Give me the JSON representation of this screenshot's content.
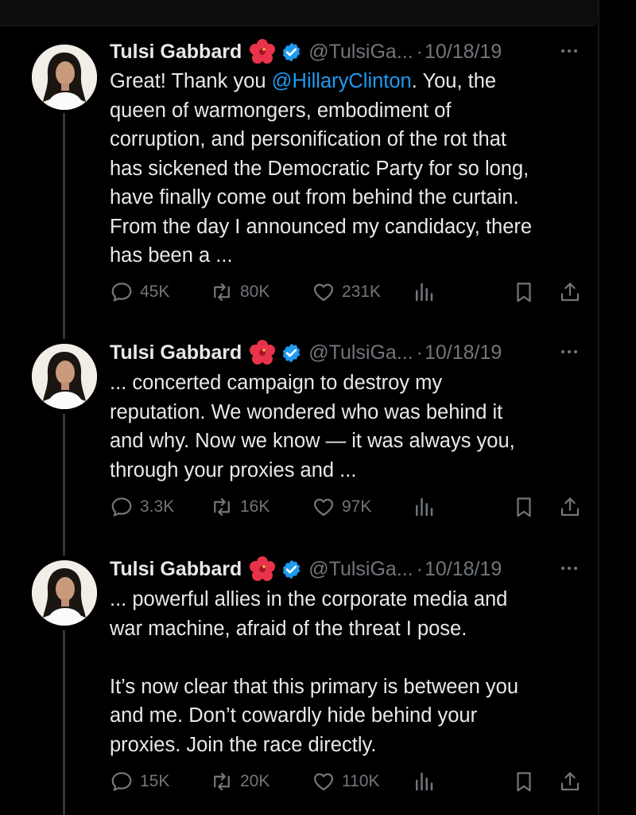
{
  "author": {
    "name": "Tulsi Gabbard",
    "handle": "@TulsiGa...",
    "emoji": "hibiscus-emoji",
    "verified_color": "#1d9bf0"
  },
  "tweets": [
    {
      "date": "10/18/19",
      "text_before": "Great! Thank you ",
      "mention": "@HillaryClinton",
      "text_after": ". You, the\nqueen of warmongers, embodiment of\ncorruption, and personification of the rot that\nhas sickened the Democratic Party for so long,\nhave finally come out from behind the curtain.\nFrom the day I announced my candidacy, there\nhas been a ...",
      "replies": "45K",
      "retweets": "80K",
      "likes": "231K"
    },
    {
      "date": "10/18/19",
      "text": "... concerted campaign to destroy my\nreputation. We wondered who was behind it\nand why. Now we know — it was always you,\nthrough your proxies and ...",
      "replies": "3.3K",
      "retweets": "16K",
      "likes": "97K"
    },
    {
      "date": "10/18/19",
      "text": "... powerful allies in the corporate media and\nwar machine, afraid of the threat I pose.\n\nIt’s now clear that this primary is between you\nand me. Don’t cowardly hide behind your\nproxies. Join the race directly.",
      "replies": "15K",
      "retweets": "20K",
      "likes": "110K"
    }
  ],
  "separator": "·",
  "colors": {
    "background": "#000000",
    "text": "#e7e9ea",
    "muted": "#71767b",
    "link": "#1d9bf0"
  }
}
